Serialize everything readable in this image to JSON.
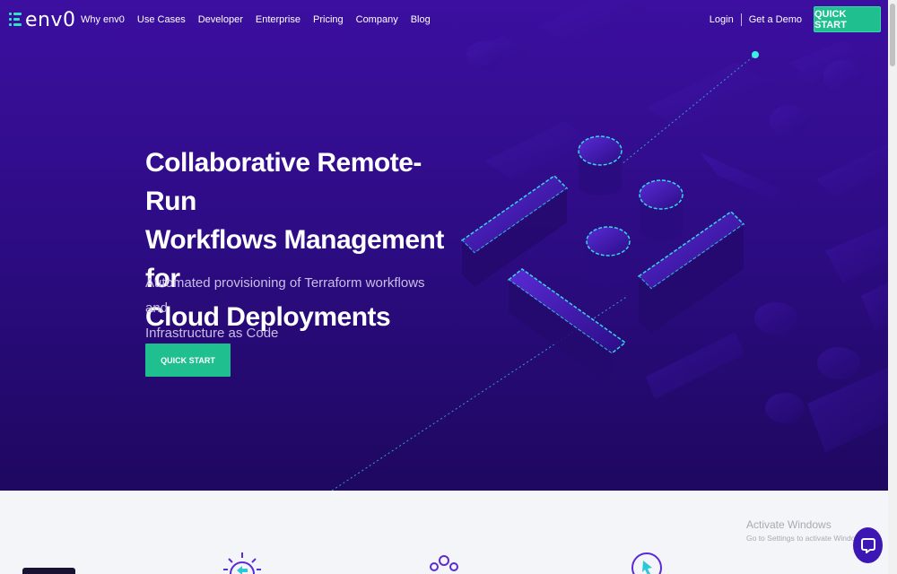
{
  "nav": {
    "logo_text": "env0",
    "menu": [
      "Why env0",
      "Use Cases",
      "Developer",
      "Enterprise",
      "Pricing",
      "Company",
      "Blog"
    ],
    "login": "Login",
    "demo": "Get a Demo",
    "cta": "QUICK START"
  },
  "hero": {
    "title_lines": [
      "Collaborative Remote-Run",
      "Workflows Management for",
      "Cloud Deployments"
    ],
    "subtitle_lines": [
      "Automated provisioning of Terraform workflows and",
      "Infrastructure as Code"
    ],
    "cta": "QUICK START"
  },
  "watermark": {
    "title": "Activate Windows",
    "subtitle": "Go to Settings to activate Windows."
  },
  "colors": {
    "hero_top": "#3c0fa0",
    "hero_bottom": "#1e0860",
    "accent_green": "#1fbf8f",
    "accent_cyan": "#33e1c4"
  },
  "icons": [
    "gear-sync-icon",
    "team-icon",
    "cursor-play-icon",
    "chat-icon"
  ]
}
